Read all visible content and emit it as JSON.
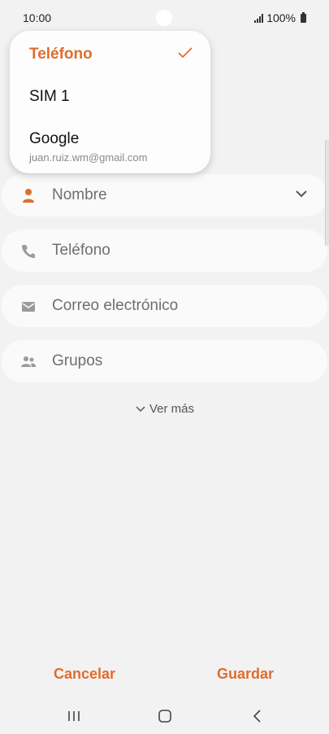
{
  "status_bar": {
    "time": "10:00",
    "battery": "100%"
  },
  "account_menu": {
    "items": [
      {
        "label": "Teléfono",
        "selected": true
      },
      {
        "label": "SIM 1"
      },
      {
        "label": "Google",
        "sublabel": "juan.ruiz.wm@gmail.com"
      }
    ]
  },
  "form": {
    "name_placeholder": "Nombre",
    "phone_placeholder": "Teléfono",
    "email_placeholder": "Correo electrónico",
    "groups_label": "Grupos"
  },
  "see_more_label": "Ver más",
  "actions": {
    "cancel": "Cancelar",
    "save": "Guardar"
  },
  "colors": {
    "accent": "#e06d2f",
    "background": "#f2f2f2",
    "field": "#fafafa"
  }
}
